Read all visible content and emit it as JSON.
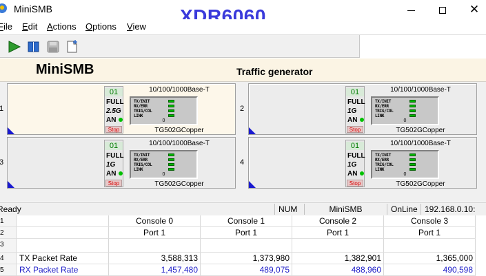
{
  "window": {
    "title": "MiniSMB",
    "watermark": "XDR6060",
    "controls": {
      "minimize": "minimize",
      "maximize": "maximize",
      "close": "✕"
    }
  },
  "menu": [
    {
      "label": "File",
      "u": "F",
      "rest": "ile"
    },
    {
      "label": "Edit",
      "u": "E",
      "rest": "dit"
    },
    {
      "label": "Actions",
      "u": "A",
      "rest": "ctions"
    },
    {
      "label": "Options",
      "u": "O",
      "rest": "ptions"
    },
    {
      "label": "View",
      "u": "V",
      "rest": "iew"
    }
  ],
  "toolbar": {
    "icons": [
      "play-icon",
      "book-icon",
      "disk-icon",
      "new-document-icon"
    ],
    "colors": {
      "play": "#2e9b2e",
      "book": "#2d6bcc"
    }
  },
  "header": {
    "brand": "MiniSMB",
    "subtitle": "Traffic generator"
  },
  "ports": [
    {
      "number": "1",
      "id": "01",
      "duplex": "FULL",
      "speed": "2.5G",
      "an": "AN",
      "stop": "Stop",
      "media": "10/100/1000Base-T",
      "leds": [
        "TX/INIT",
        "RX/ERR",
        "TRIG/COL",
        "LINK"
      ],
      "counter": "0",
      "model": "TG502GCopper",
      "active": true
    },
    {
      "number": "2",
      "id": "01",
      "duplex": "FULL",
      "speed": "1G",
      "an": "AN",
      "stop": "Stop",
      "media": "10/100/1000Base-T",
      "leds": [
        "TX/INIT",
        "RX/ERR",
        "TRIG/COL",
        "LINK"
      ],
      "counter": "0",
      "model": "TG502GCopper",
      "active": false
    },
    {
      "number": "3",
      "id": "01",
      "duplex": "FULL",
      "speed": "1G",
      "an": "AN",
      "stop": "Stop",
      "media": "10/100/1000Base-T",
      "leds": [
        "TX/INIT",
        "RX/ERR",
        "TRIG/COL",
        "LINK"
      ],
      "counter": "0",
      "model": "TG502GCopper",
      "active": false
    },
    {
      "number": "4",
      "id": "01",
      "duplex": "FULL",
      "speed": "1G",
      "an": "AN",
      "stop": "Stop",
      "media": "10/100/1000Base-T",
      "leds": [
        "TX/INIT",
        "RX/ERR",
        "TRIG/COL",
        "LINK"
      ],
      "counter": "0",
      "model": "TG502GCopper",
      "active": false
    }
  ],
  "statusbar": {
    "ready": "Ready",
    "num": "NUM",
    "app": "MiniSMB",
    "online": "OnLine",
    "ip": "192.168.0.10:"
  },
  "grid": {
    "row_headers": [
      "1",
      "2",
      "3",
      "4",
      "5"
    ],
    "consoles": [
      "Console 0",
      "Console 1",
      "Console 2",
      "Console 3"
    ],
    "ports": [
      "Port 1",
      "Port 1",
      "Port 1",
      "Port 1"
    ],
    "rows": [
      {
        "label": "TX Packet Rate",
        "values": [
          "3,588,313",
          "1,373,980",
          "1,382,901",
          "1,365,000"
        ],
        "color": "#000000"
      },
      {
        "label": "RX Packet Rate",
        "values": [
          "1,457,480",
          "489,075",
          "488,960",
          "490,598"
        ],
        "color": "#2020c8"
      }
    ]
  }
}
